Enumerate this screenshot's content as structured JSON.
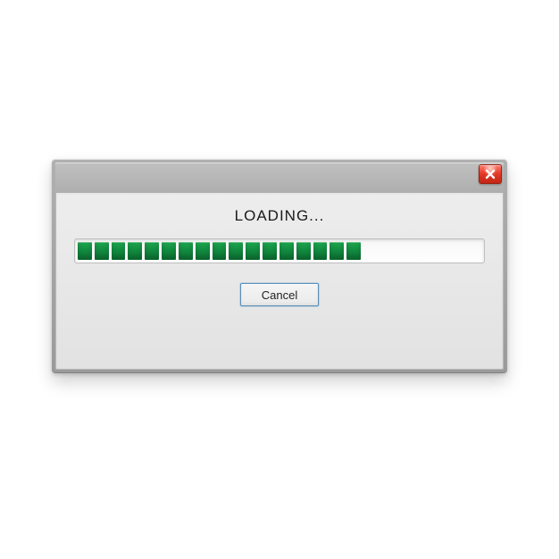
{
  "dialog": {
    "title": "LOADING...",
    "cancel_label": "Cancel",
    "progress": {
      "segments_total": 24,
      "segments_filled": 17
    },
    "colors": {
      "progress_fill": "#118a3f",
      "close_button": "#e63b29"
    }
  }
}
